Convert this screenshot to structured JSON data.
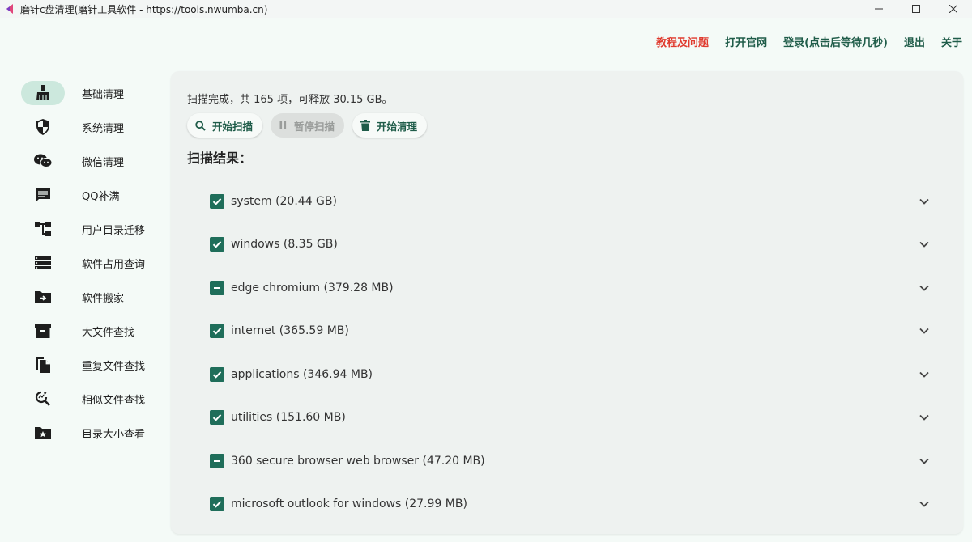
{
  "window": {
    "title": "磨针c盘清理(磨针工具软件 - https://tools.nwumba.cn)",
    "icons": [
      "app-logo-icon",
      "minimize-icon",
      "maximize-icon",
      "close-icon"
    ]
  },
  "topnav": {
    "tutorial": "教程及问题",
    "website": "打开官网",
    "login": "登录(点击后等待几秒)",
    "logout": "退出",
    "about": "关于"
  },
  "colors": {
    "accent": "#1f6e5a",
    "nav_text": "#1f5c49",
    "tutorial_red": "#e03b2f",
    "active_bg": "#cce8dd"
  },
  "sidebar": {
    "items": [
      {
        "label": "基础清理",
        "icon": "broom-icon",
        "active": true
      },
      {
        "label": "系统清理",
        "icon": "shield-icon"
      },
      {
        "label": "微信清理",
        "icon": "wechat-icon"
      },
      {
        "label": "QQ补满",
        "icon": "chat-icon"
      },
      {
        "label": "用户目录迁移",
        "icon": "tree-icon"
      },
      {
        "label": "软件占用查询",
        "icon": "list-icon"
      },
      {
        "label": "软件搬家",
        "icon": "folder-move-icon"
      },
      {
        "label": "大文件查找",
        "icon": "archive-icon"
      },
      {
        "label": "重复文件查找",
        "icon": "copy-icon"
      },
      {
        "label": "相似文件查找",
        "icon": "search-refresh-icon"
      },
      {
        "label": "目录大小查看",
        "icon": "folder-star-icon"
      }
    ]
  },
  "main": {
    "summary": "扫描完成，共 165 项，可释放 30.15 GB。",
    "buttons": {
      "start_scan": "开始扫描",
      "pause_scan": "暂停扫描",
      "start_clean": "开始清理"
    },
    "results_title": "扫描结果：",
    "results": [
      {
        "label": "system (20.44 GB)",
        "state": "checked"
      },
      {
        "label": "windows (8.35 GB)",
        "state": "checked"
      },
      {
        "label": "edge chromium (379.28 MB)",
        "state": "indeterminate"
      },
      {
        "label": "internet (365.59 MB)",
        "state": "checked"
      },
      {
        "label": "applications (346.94 MB)",
        "state": "checked"
      },
      {
        "label": "utilities (151.60 MB)",
        "state": "checked"
      },
      {
        "label": "360 secure browser web browser (47.20 MB)",
        "state": "indeterminate"
      },
      {
        "label": "microsoft outlook for windows (27.99 MB)",
        "state": "checked"
      }
    ]
  }
}
